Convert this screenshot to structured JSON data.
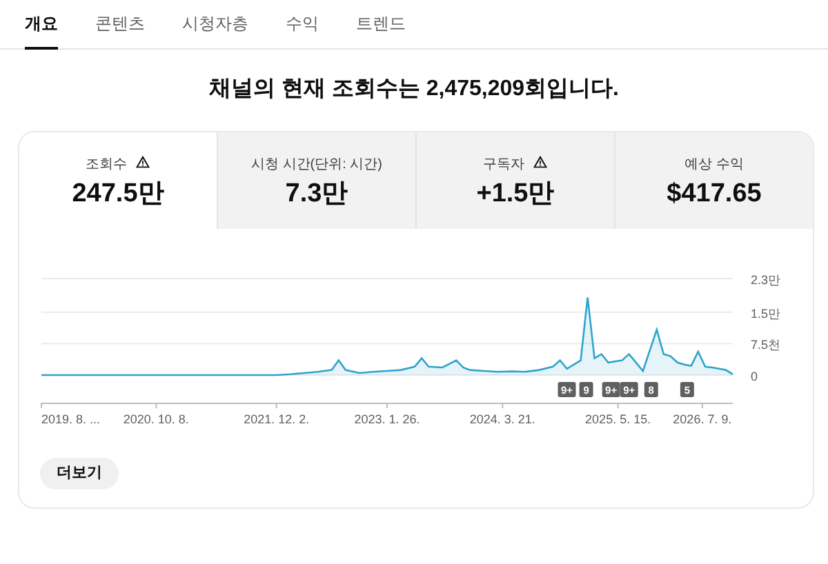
{
  "tabs": [
    {
      "label": "개요",
      "selected": true
    },
    {
      "label": "콘텐츠",
      "selected": false
    },
    {
      "label": "시청자층",
      "selected": false
    },
    {
      "label": "수익",
      "selected": false
    },
    {
      "label": "트렌드",
      "selected": false
    }
  ],
  "headline": "채널의 현재 조회수는 2,475,209회입니다.",
  "metrics": [
    {
      "label": "조회수",
      "value": "247.5만",
      "warning": true,
      "selected": true
    },
    {
      "label": "시청 시간(단위: 시간)",
      "value": "7.3만",
      "warning": false,
      "selected": false
    },
    {
      "label": "구독자",
      "value": "+1.5만",
      "warning": true,
      "selected": false
    },
    {
      "label": "예상 수익",
      "value": "$417.65",
      "warning": false,
      "selected": false
    }
  ],
  "chart": {
    "y_axis_labels": [
      "2.3만",
      "1.5만",
      "7.5천",
      "0"
    ],
    "x_axis_labels": [
      "2019. 8. ...",
      "2020. 10. 8.",
      "2021. 12. 2.",
      "2023. 1. 26.",
      "2024. 3. 21.",
      "2025. 5. 15.",
      "2026. 7. 9."
    ],
    "video_badges": [
      "9+",
      "9",
      "9+",
      "9+",
      "8",
      "5"
    ]
  },
  "more_button": "더보기"
}
